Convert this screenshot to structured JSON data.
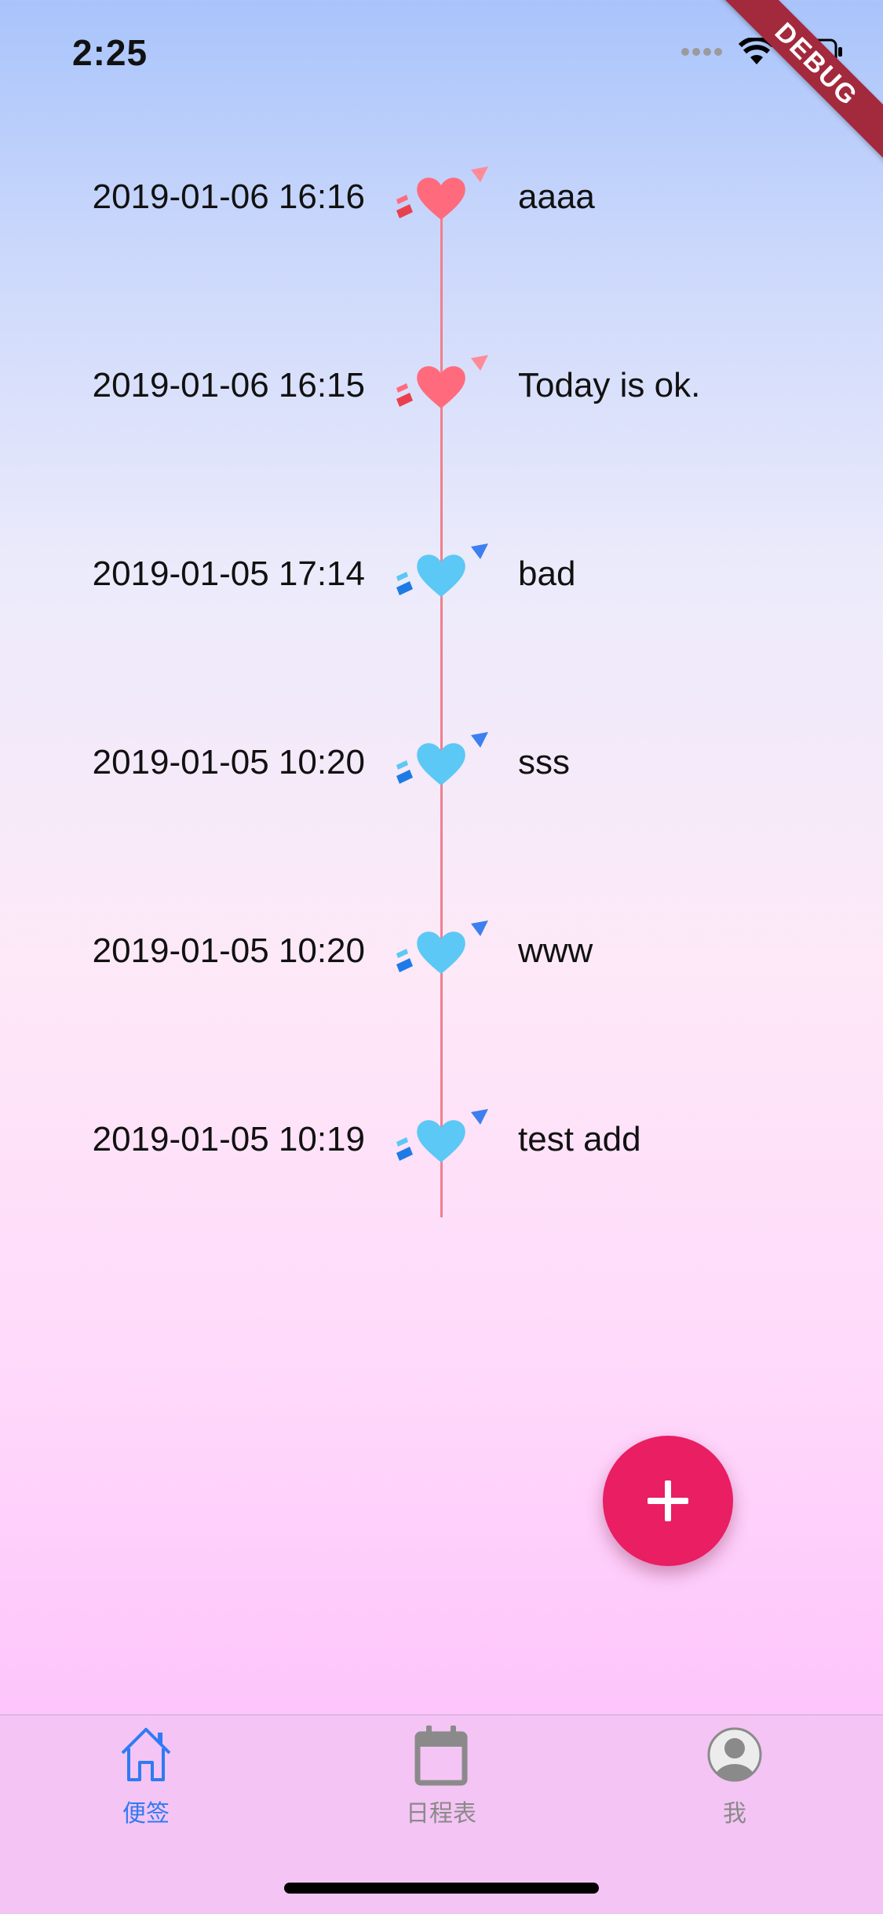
{
  "status_bar": {
    "time": "2:25",
    "debug_label": "DEBUG"
  },
  "timeline": {
    "entries": [
      {
        "date": "2019-01-06 16:16",
        "text": "aaaa",
        "mood": "good",
        "color": "#ff6b7d"
      },
      {
        "date": "2019-01-06 16:15",
        "text": "Today is ok.",
        "mood": "good",
        "color": "#ff6b7d"
      },
      {
        "date": "2019-01-05 17:14",
        "text": "bad",
        "mood": "bad",
        "color": "#5cc8f5"
      },
      {
        "date": "2019-01-05 10:20",
        "text": "sss",
        "mood": "bad",
        "color": "#5cc8f5"
      },
      {
        "date": "2019-01-05 10:20",
        "text": "www",
        "mood": "bad",
        "color": "#5cc8f5"
      },
      {
        "date": "2019-01-05 10:19",
        "text": "test add",
        "mood": "bad",
        "color": "#5cc8f5"
      }
    ],
    "line_color": "#f07f8d"
  },
  "fab": {
    "icon": "plus-icon",
    "color": "#e91e63"
  },
  "tabs": [
    {
      "label": "便签",
      "icon": "home-icon",
      "active": true
    },
    {
      "label": "日程表",
      "icon": "calendar-icon",
      "active": false
    },
    {
      "label": "我",
      "icon": "profile-icon",
      "active": false
    }
  ],
  "colors": {
    "accent": "#2e7bf4",
    "inactive": "#8a8a8a"
  }
}
